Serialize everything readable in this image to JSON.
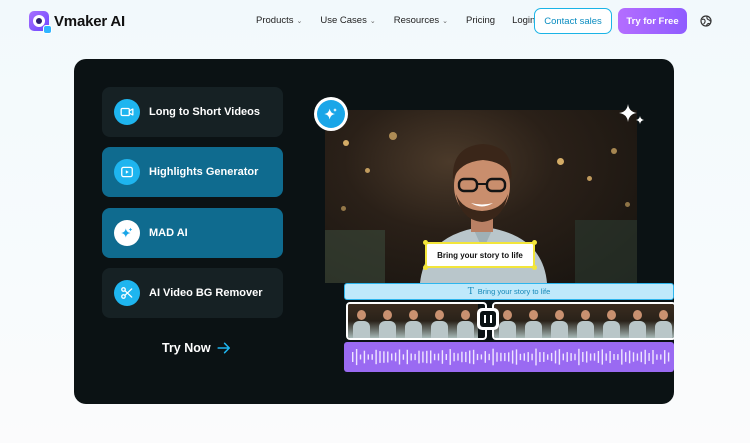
{
  "header": {
    "brand": "Vmaker AI",
    "menu": [
      {
        "label": "Products",
        "has_dropdown": true
      },
      {
        "label": "Use Cases",
        "has_dropdown": true
      },
      {
        "label": "Resources",
        "has_dropdown": true
      },
      {
        "label": "Pricing",
        "has_dropdown": false
      },
      {
        "label": "Login",
        "has_dropdown": false
      }
    ],
    "contact_label": "Contact sales",
    "try_label": "Try for Free",
    "globe_icon": "globe-icon"
  },
  "features": [
    {
      "label": "Long to Short Videos",
      "icon": "video-camera-icon",
      "active": false
    },
    {
      "label": "Highlights Generator",
      "icon": "play-icon",
      "active": true
    },
    {
      "label": "MAD AI",
      "icon": "sparkle-icon",
      "active": true
    },
    {
      "label": "AI Video BG Remover",
      "icon": "scissors-icon",
      "active": false
    }
  ],
  "try_now_label": "Try Now",
  "preview": {
    "caption": "Bring your story to life",
    "text_track": "Bring your story to life"
  },
  "colors": {
    "accent": "#1eb5ef",
    "brand_purple": "#9a6af2",
    "panel_bg": "#0b1214",
    "active_feature": "#0f6b8f"
  }
}
